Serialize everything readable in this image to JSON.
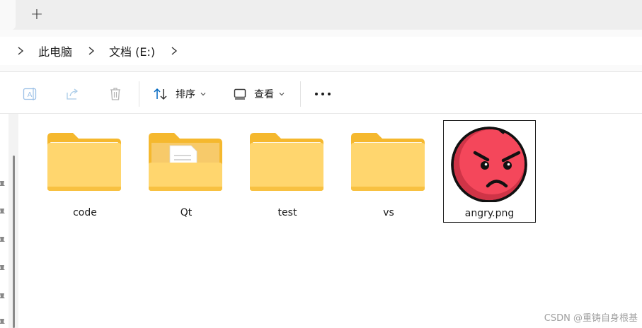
{
  "tabs": {
    "new_tab_label": "+"
  },
  "address": {
    "breadcrumbs": [
      "此电脑",
      "文档 (E:)"
    ]
  },
  "command_bar": {
    "sort_label": "排序",
    "view_label": "查看"
  },
  "files": [
    {
      "name": "code",
      "type": "folder"
    },
    {
      "name": "Qt",
      "type": "folder-with-document"
    },
    {
      "name": "test",
      "type": "folder"
    },
    {
      "name": "vs",
      "type": "folder"
    },
    {
      "name": "angry.png",
      "type": "image",
      "selected": true
    }
  ],
  "watermark": "CSDN @重铸自身根基",
  "colors": {
    "folder_back": "#F5B82E",
    "folder_front": "#FFD66E",
    "accent": "#0067C0",
    "emoji_face": "#F4475B",
    "emoji_shadow": "#CF3447"
  }
}
